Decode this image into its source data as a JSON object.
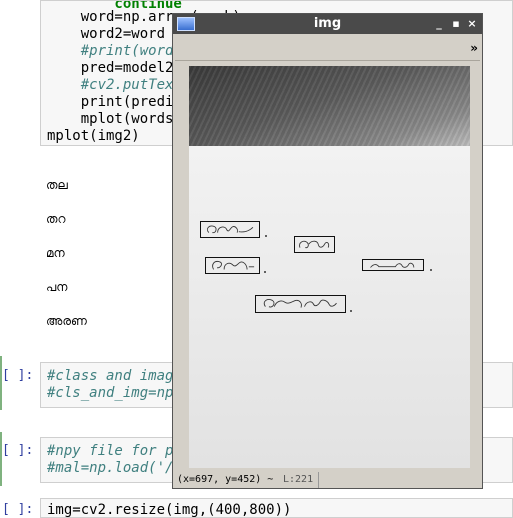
{
  "notebook": {
    "code_lines": [
      {
        "text": "        continue",
        "cls": "kw"
      },
      {
        "text": "    word=np.array(mask)",
        "cls": ""
      },
      {
        "text": "    word2=word",
        "cls": ""
      },
      {
        "text": "    #print(word.shape)",
        "cls": "cm"
      },
      {
        "text": "    pred=model2.predict(word.reshape(1,64,64,1))",
        "cls": ""
      },
      {
        "text": "    #cv2.putText(img,predicted,(x,y),1,0.3",
        "cls": "cm"
      },
      {
        "text": "    print(predicted)",
        "cls": ""
      },
      {
        "text": "    mplot(words[i])",
        "cls": ""
      },
      {
        "text": "mplot(img2)",
        "cls": ""
      }
    ],
    "outputs": [
      "തല",
      "തറ",
      "മന",
      "പന",
      "അരണ"
    ],
    "cells": [
      {
        "prompt": "[ ]:",
        "lines": [
          "#class and images",
          "#cls_and_img=np.load('/home/../labels.npy')"
        ]
      },
      {
        "prompt": "[ ]:",
        "lines": [
          "#npy file for prediction",
          "#mal=np.load('/home/...')"
        ]
      },
      {
        "prompt": "[ ]:",
        "lines": [
          "img=cv2.resize(img,(400,800))"
        ]
      }
    ]
  },
  "window": {
    "title": "img",
    "minimize": "_",
    "maximize": "▪",
    "close": "×",
    "toolbar_more": "»",
    "status_coords": "(x=697, y=452) ~",
    "status_l": "L:221"
  }
}
